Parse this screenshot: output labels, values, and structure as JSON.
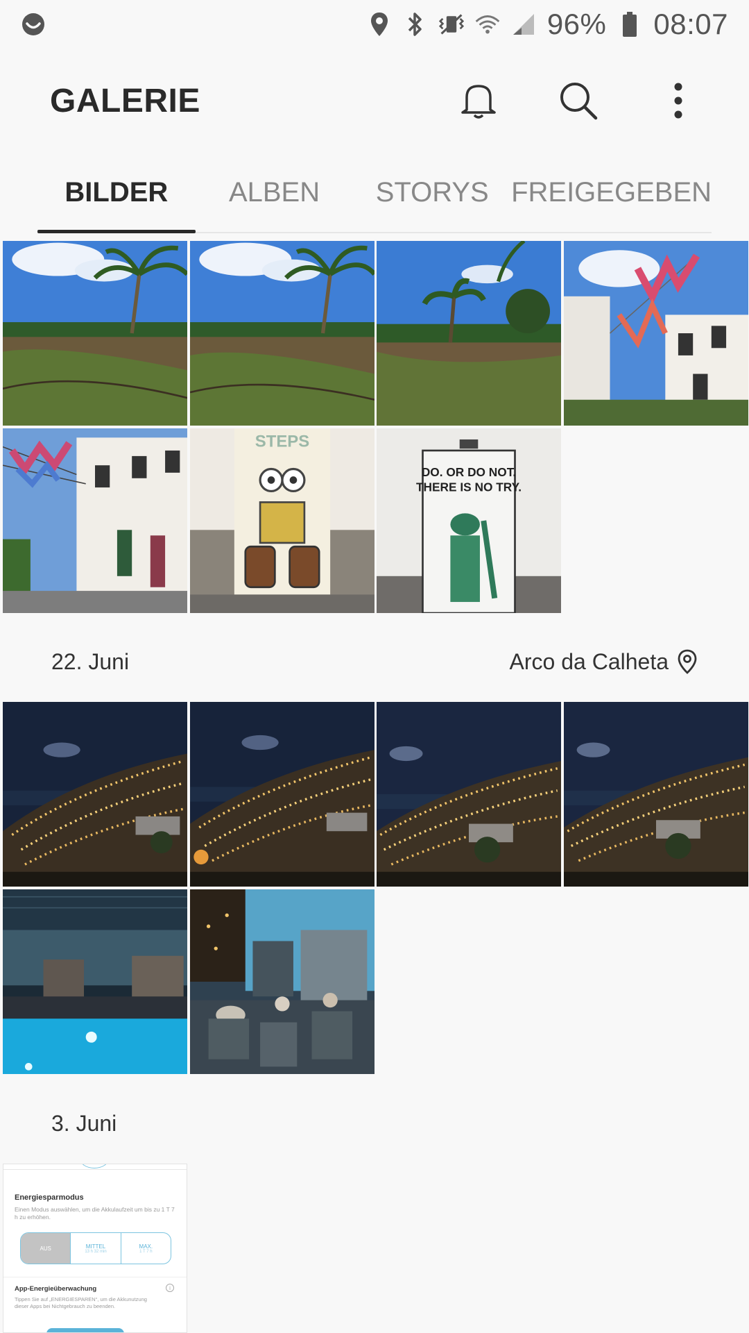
{
  "status_bar": {
    "battery": "96%",
    "time": "08:07",
    "icons": [
      "assistant-icon",
      "location-icon",
      "bluetooth-icon",
      "vibrate-icon",
      "wifi-icon",
      "signal-icon",
      "battery-icon"
    ]
  },
  "app": {
    "title": "GALERIE",
    "actions": [
      "notification-bell-icon",
      "search-icon",
      "more-options-icon"
    ]
  },
  "tabs": [
    {
      "label": "BILDER",
      "active": true
    },
    {
      "label": "ALBEN",
      "active": false
    },
    {
      "label": "STORYS",
      "active": false
    },
    {
      "label": "FREIGEGEBEN",
      "active": false
    }
  ],
  "sections": [
    {
      "date": "22. Juni",
      "location": "Arco da Calheta"
    },
    {
      "date": "3. Juni",
      "location": ""
    }
  ],
  "screenshot_thumbnail": {
    "heading": "Energiesparmodus",
    "description": "Einen Modus auswählen, um die Akkulaufzeit um bis zu 1 T 7 h zu erhöhen.",
    "options": [
      "AUS",
      "MITTEL",
      "MAX."
    ],
    "option_subs": [
      "",
      "13 h 32 min",
      "1 T 7 h"
    ],
    "section2_heading": "App-Energieüberwachung",
    "section2_text": "Tippen Sie auf „ENERGIESPAREN“, um die Akkunutzung dieser Apps bei Nichtgebrauch zu beenden."
  },
  "colors": {
    "background": "#f8f8f8",
    "text_primary": "#2a2a2a",
    "text_secondary": "#888888",
    "accent_blue": "#5ab3d8"
  }
}
